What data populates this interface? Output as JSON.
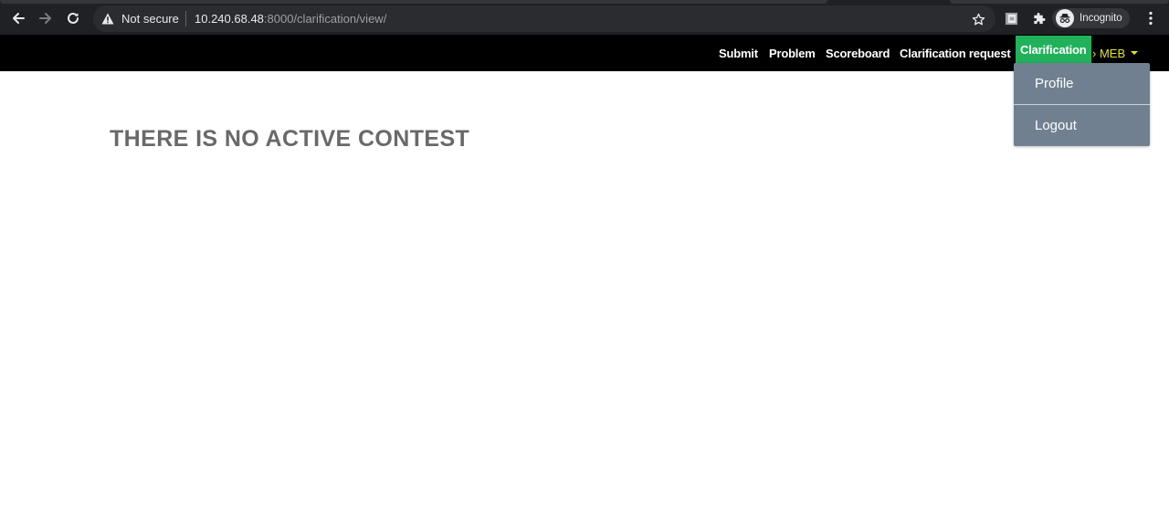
{
  "browser": {
    "security_label": "Not secure",
    "url_host": "10.240.68.48",
    "url_path": ":8000/clarification/view/",
    "profile_label": "Incognito"
  },
  "navbar": {
    "items": [
      {
        "label": "Submit"
      },
      {
        "label": "Problem"
      },
      {
        "label": "Scoreboard"
      },
      {
        "label": "Clarification request"
      },
      {
        "label": "Clarification",
        "active": true
      }
    ],
    "user_label": "› MEB",
    "active_color": "#20b15a",
    "user_color": "#e3e324"
  },
  "dropdown": {
    "items": [
      {
        "label": "Profile"
      },
      {
        "label": "Logout"
      }
    ],
    "background": "#708090"
  },
  "main": {
    "heading": "THERE IS NO ACTIVE CONTEST"
  },
  "icons": {
    "back": "arrow-left-icon",
    "forward": "arrow-right-icon",
    "reload": "reload-icon",
    "warning": "warning-triangle-icon",
    "bookmark": "star-icon",
    "extension_page": "extension-page-icon",
    "extensions": "puzzle-icon",
    "incognito": "incognito-icon",
    "menu": "kebab-menu-icon"
  }
}
